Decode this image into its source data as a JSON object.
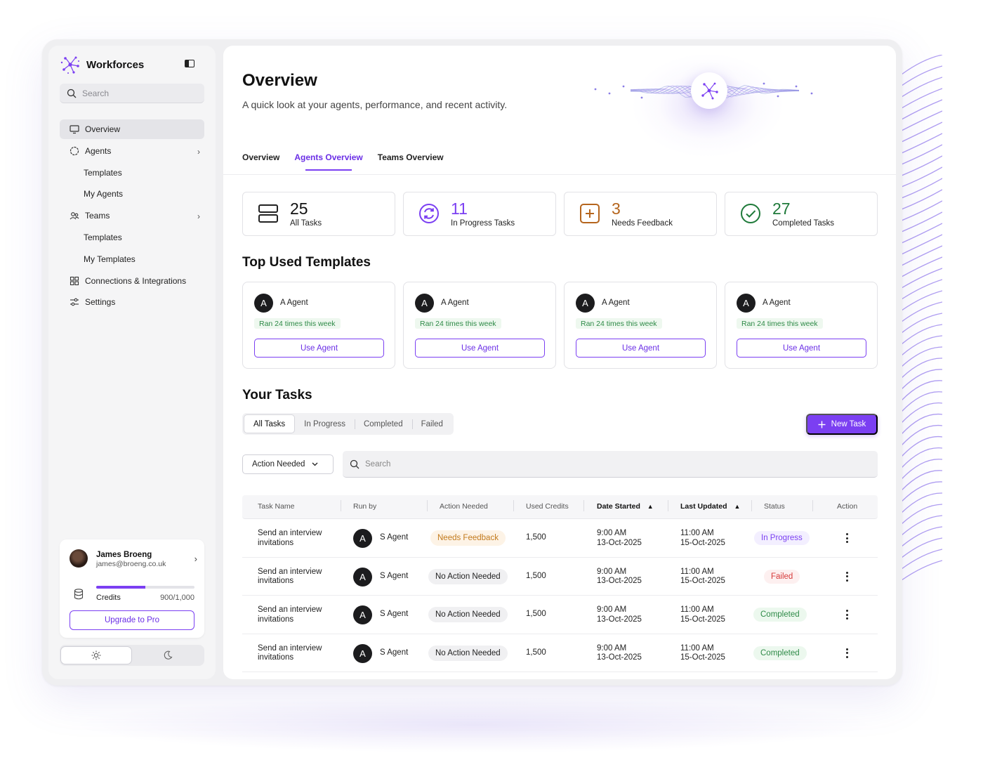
{
  "brand": {
    "name": "Workforces"
  },
  "sidebar": {
    "search_placeholder": "Search",
    "items": [
      {
        "label": "Overview",
        "icon": "monitor-icon",
        "active": true
      },
      {
        "label": "Agents",
        "icon": "agent-icon",
        "expandable": true
      },
      {
        "label": "Templates",
        "sub": true
      },
      {
        "label": "My Agents",
        "sub": true
      },
      {
        "label": "Teams",
        "icon": "team-icon",
        "expandable": true
      },
      {
        "label": "Templates",
        "sub": true
      },
      {
        "label": "My Templates",
        "sub": true
      },
      {
        "label": "Connections & Integrations",
        "icon": "grid-icon"
      },
      {
        "label": "Settings",
        "icon": "settings-icon"
      }
    ]
  },
  "user": {
    "name": "James Broeng",
    "email": "james@broeng.co.uk",
    "credits_label": "Credits",
    "credits_value": "900/1,000",
    "credits_used_fraction": 0.5,
    "upgrade_label": "Upgrade to Pro"
  },
  "theme": {
    "light_icon": "sun-icon",
    "dark_icon": "moon-icon"
  },
  "page": {
    "title": "Overview",
    "subtitle": "A quick look at your agents, performance, and recent activity."
  },
  "tabs": [
    {
      "label": "Overview",
      "active": false
    },
    {
      "label": "Agents Overview",
      "active": true
    },
    {
      "label": "Teams Overview",
      "active": false
    }
  ],
  "stats": [
    {
      "value": "25",
      "label": "All Tasks",
      "icon": "stack-icon",
      "color": "#222222"
    },
    {
      "value": "11",
      "label": "In Progress Tasks",
      "icon": "refresh-icon",
      "color": "#7b3ff2"
    },
    {
      "value": "3",
      "label": "Needs Feedback",
      "icon": "plus-square-icon",
      "color": "#b5651d"
    },
    {
      "value": "27",
      "label": "Completed Tasks",
      "icon": "check-circle-icon",
      "color": "#1f7a3a"
    }
  ],
  "templates_section": {
    "title": "Top Used Templates",
    "cards": [
      {
        "avatar": "A",
        "name": "A Agent",
        "badge": "Ran 24 times this week",
        "button": "Use Agent"
      },
      {
        "avatar": "A",
        "name": "A Agent",
        "badge": "Ran 24 times this week",
        "button": "Use Agent"
      },
      {
        "avatar": "A",
        "name": "A Agent",
        "badge": "Ran 24 times this week",
        "button": "Use Agent"
      },
      {
        "avatar": "A",
        "name": "A Agent",
        "badge": "Ran 24 times this week",
        "button": "Use Agent"
      }
    ]
  },
  "tasks": {
    "title": "Your Tasks",
    "segments": [
      "All Tasks",
      "In Progress",
      "Completed",
      "Failed"
    ],
    "new_task_label": "New Task",
    "filter_label": "Action Needed",
    "search_placeholder": "Search",
    "columns": [
      "Task Name",
      "Run by",
      "Action Needed",
      "Used Credits",
      "Date Started",
      "Last Updated",
      "Status",
      "Action"
    ],
    "rows": [
      {
        "name": "Send an interview invitations",
        "avatar": "A",
        "run_by": "S Agent",
        "action": "Needs Feedback",
        "action_type": "feedback",
        "credits": "1,500",
        "started_time": "9:00 AM",
        "started_date": "13-Oct-2025",
        "updated_time": "11:00 AM",
        "updated_date": "15-Oct-2025",
        "status": "In Progress",
        "status_type": "progress"
      },
      {
        "name": "Send an interview invitations",
        "avatar": "A",
        "run_by": "S Agent",
        "action": "No Action Needed",
        "action_type": "noaction",
        "credits": "1,500",
        "started_time": "9:00 AM",
        "started_date": "13-Oct-2025",
        "updated_time": "11:00 AM",
        "updated_date": "15-Oct-2025",
        "status": "Failed",
        "status_type": "failed"
      },
      {
        "name": "Send an interview invitations",
        "avatar": "A",
        "run_by": "S Agent",
        "action": "No Action Needed",
        "action_type": "noaction",
        "credits": "1,500",
        "started_time": "9:00 AM",
        "started_date": "13-Oct-2025",
        "updated_time": "11:00 AM",
        "updated_date": "15-Oct-2025",
        "status": "Completed",
        "status_type": "completed"
      },
      {
        "name": "Send an interview invitations",
        "avatar": "A",
        "run_by": "S Agent",
        "action": "No Action Needed",
        "action_type": "noaction",
        "credits": "1,500",
        "started_time": "9:00 AM",
        "started_date": "13-Oct-2025",
        "updated_time": "11:00 AM",
        "updated_date": "15-Oct-2025",
        "status": "Completed",
        "status_type": "completed"
      }
    ]
  },
  "colors": {
    "accent": "#7b3ff2",
    "success": "#2e8a47",
    "danger": "#d63a3a",
    "warning": "#c27a1c"
  }
}
